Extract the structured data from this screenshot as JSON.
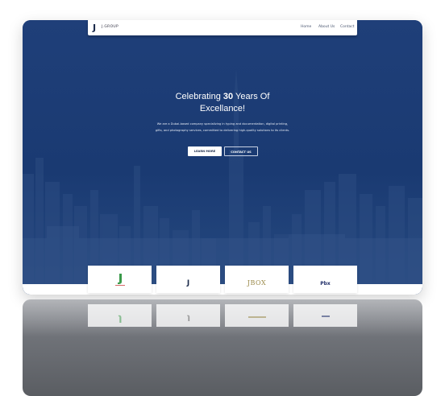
{
  "navbar": {
    "logo_mark": "J",
    "logo_text": "J.GROUP",
    "items": [
      {
        "label": "Home"
      },
      {
        "label": "About Us"
      },
      {
        "label": "Contact"
      }
    ]
  },
  "hero": {
    "title_before": "Celebrating ",
    "title_number": "30",
    "title_after": " Years Of",
    "title_line2": "Excellance!",
    "description": "We are a Dubai-based company specializing in typing and documentation, digital printing, gifts, and photography services, committed to delivering high-quality solutions to its clients.",
    "buttons": {
      "learn_more": "LEARN MORE",
      "contact_us": "CONTACT US"
    }
  },
  "partners": [
    {
      "logo": "J",
      "icon": "j-green-logo-icon"
    },
    {
      "logo": "J",
      "icon": "j-small-logo-icon"
    },
    {
      "logo": "JBOX",
      "icon": "jbox-logo-icon"
    },
    {
      "logo": "Pbx",
      "icon": "pbx-logo-icon"
    }
  ],
  "colors": {
    "hero_blue": "#1c3b73",
    "accent_green": "#3a9a4a",
    "gold": "#9b8a4a",
    "navy": "#1b2a4a"
  }
}
